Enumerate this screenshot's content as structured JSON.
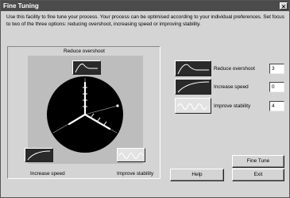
{
  "window": {
    "title": "Fine Tuning",
    "close_glyph": "×"
  },
  "description": "Use this facility to fine tune your process. Your process can be optimised according to your individual preferences. Set focus to two of the three options: reducing overshoot, increasing speed or improving stability.",
  "dial": {
    "label_top": "Reduce overshoot",
    "label_bottom_left": "Increase speed",
    "label_bottom_right": "Improve stability"
  },
  "options": [
    {
      "label": "Reduce overshoot",
      "value": "3",
      "icon": "overshoot-curve-icon"
    },
    {
      "label": "Increase speed",
      "value": "0",
      "icon": "speed-curve-icon"
    },
    {
      "label": "Improve stability",
      "value": "4",
      "icon": "stability-wave-icon"
    }
  ],
  "buttons": {
    "fine_tune": "Fine Tune",
    "help": "Help",
    "exit": "Exit"
  },
  "colors": {
    "titlebar": "#4b4b4b",
    "dial": "#000000",
    "panel": "#d4d4d4"
  }
}
